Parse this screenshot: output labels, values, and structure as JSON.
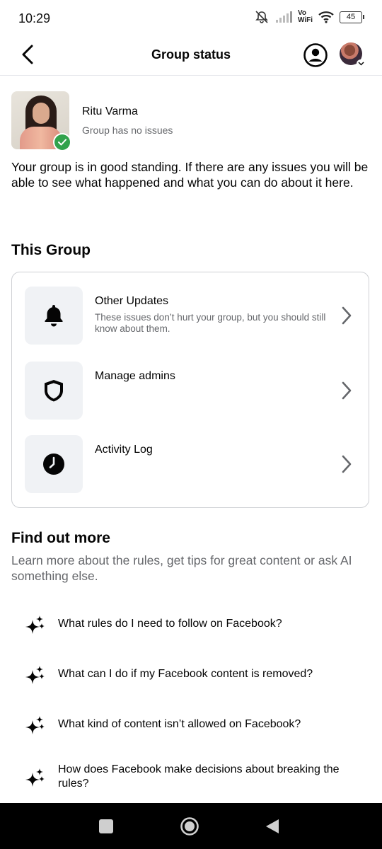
{
  "status_bar": {
    "time": "10:29",
    "network": "Vo\nWiFi",
    "battery": "45"
  },
  "header": {
    "title": "Group status"
  },
  "group": {
    "name": "Ritu Varma",
    "status": "Group has no issues"
  },
  "intro": "Your group is in good standing. If there are any issues you will be able to see what happened and what you can do about it here.",
  "this_group": {
    "title": "This Group",
    "items": [
      {
        "label": "Other Updates",
        "description": "These issues don’t hurt your group, but you should still know about them.",
        "icon": "bell-icon"
      },
      {
        "label": "Manage admins",
        "description": "",
        "icon": "shield-icon"
      },
      {
        "label": "Activity Log",
        "description": "",
        "icon": "clock-icon"
      }
    ]
  },
  "find_out_more": {
    "title": "Find out more",
    "description": "Learn more about the rules, get tips for great content or ask AI something else.",
    "questions": [
      "What rules do I need to follow on Facebook?",
      "What can I do if my Facebook content is removed?",
      "What kind of content isn’t allowed on Facebook?",
      "How does Facebook make decisions about breaking the rules?"
    ]
  },
  "colors": {
    "accent_green": "#31a24c",
    "icon_bg": "#f0f2f5",
    "secondary_text": "#65676b"
  }
}
